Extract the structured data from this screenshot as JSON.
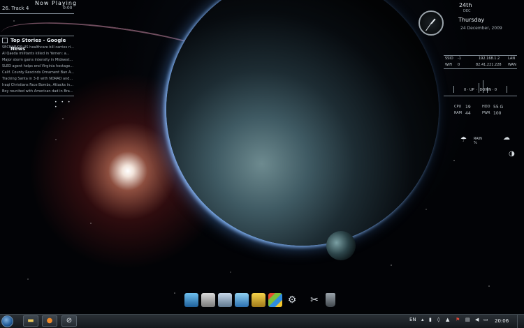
{
  "now_playing": {
    "title": "Now Playing",
    "track": "26. Track 4",
    "time": "0:00"
  },
  "news": {
    "header": "Top Stories - Google News",
    "items": [
      "SECNARIOS:US healthcare bill carries ri...",
      "Al Qaeda militants killed in Yemen: a...",
      "Major storm gains intensity in Midwest...",
      "SLED agent helps end Virginia hostage...",
      "Calif. County Rescinds Ornament Ban A...",
      "Tracking Santa in 3-D with NORAD and...",
      "Iraqi Christians Face Bombs, Attacks in...",
      "Boy reunited with American dad in Bra..."
    ],
    "dots": "• • • •"
  },
  "date": {
    "day": "24th",
    "month": "DEC",
    "weekday": "Thursday",
    "full": "24 December, 2009"
  },
  "network": {
    "ssid_label": "SSID",
    "ssid_val": "-1",
    "ip1": "192.168.1.2",
    "lan": "LAN",
    "wifi_label": "WiFi",
    "wifi_val": "0",
    "ip2": "82.41.221.228",
    "wan": "WAN",
    "up_val": "0",
    "up_label": "UP",
    "down_label": "DOWN",
    "down_val": "0"
  },
  "system": {
    "cpu_label": "CPU",
    "cpu_val": "19",
    "hdd_label": "HDD",
    "hdd_val": "55 G",
    "ram_label": "RAM",
    "ram_val": "44",
    "pwr_label": "PWR",
    "pwr_val": "100"
  },
  "weather": {
    "label": "RAIN",
    "sub": "%"
  },
  "taskbar": {
    "language": "EN",
    "clock": "20:06"
  },
  "icons": {
    "dock": [
      "monitor-icon",
      "programs-icon",
      "itunes-icon",
      "internet-icon",
      "pencil-icon",
      "windows-icon",
      "settings-gear-icon",
      "tools-icon",
      "recycle-bin-icon"
    ],
    "taskbar": [
      "explorer-folder-icon",
      "firefox-icon",
      "media-player-icon"
    ]
  }
}
